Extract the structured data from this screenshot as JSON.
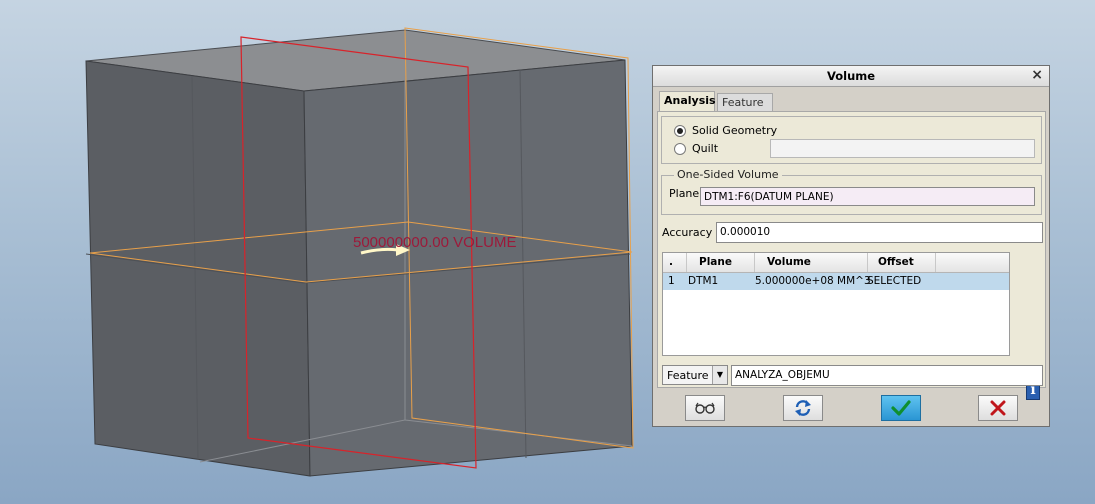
{
  "viewport": {
    "annotation_text": "500000000.00 VOLUME"
  },
  "dialog": {
    "title": "Volume",
    "tabs": [
      {
        "label": "Analysis",
        "active": true
      },
      {
        "label": "Feature",
        "active": false
      }
    ],
    "geometry_type": {
      "options": [
        {
          "label": "Solid Geometry",
          "selected": true
        },
        {
          "label": "Quilt",
          "selected": false
        }
      ],
      "quilt_value": ""
    },
    "one_sided_volume": {
      "legend": "One-Sided Volume",
      "plane_label": "Plane",
      "plane_value": "DTM1:F6(DATUM PLANE)"
    },
    "accuracy": {
      "label": "Accuracy",
      "value": "0.000010"
    },
    "results_table": {
      "columns": [
        ".",
        "Plane",
        "Volume",
        "Offset"
      ],
      "rows": [
        {
          "index": "1",
          "plane": "DTM1",
          "volume": "5.000000e+08 MM^3",
          "offset": "SELECTED",
          "selected": true
        }
      ]
    },
    "feature": {
      "type_value": "Feature",
      "name_value": "ANALYZA_OBJEMU"
    },
    "buttons": [
      "preview-icon",
      "repeat-icon",
      "check-icon",
      "cancel-x-icon"
    ],
    "colors": {
      "ok_button": "#2a95d3",
      "cancel_x": "#c0161c",
      "row_highlight": "#bfd9ec",
      "datum_plane": "#e8a04a",
      "section_plane": "#d8232a",
      "annotation": "#9c1a3a"
    }
  }
}
